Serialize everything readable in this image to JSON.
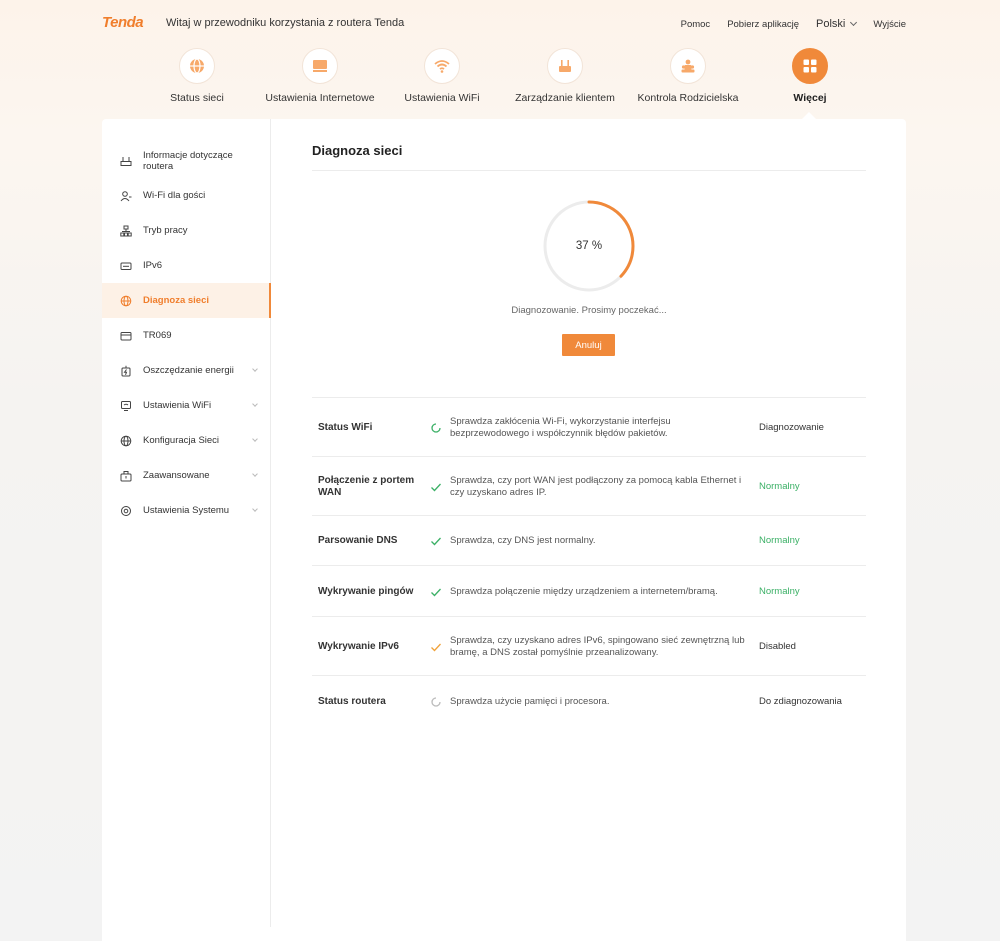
{
  "header": {
    "logo": "Tenda",
    "welcome": "Witaj w przewodniku korzystania z routera Tenda",
    "help": "Pomoc",
    "download": "Pobierz aplikację",
    "language": "Polski",
    "logout": "Wyjście"
  },
  "nav": {
    "items": [
      {
        "label": "Status sieci",
        "icon": "globe-icon"
      },
      {
        "label": "Ustawienia Internetowe",
        "icon": "ethernet-icon"
      },
      {
        "label": "Ustawienia WiFi",
        "icon": "wifi-icon"
      },
      {
        "label": "Zarządzanie klientem",
        "icon": "router-icon"
      },
      {
        "label": "Kontrola Rodzicielska",
        "icon": "family-icon"
      },
      {
        "label": "Więcej",
        "icon": "grid-icon"
      }
    ],
    "active_index": 5,
    "accent_color": "#f0893a"
  },
  "sidebar": {
    "items": [
      {
        "label": "Informacje dotyczące routera",
        "icon": "router-info-icon"
      },
      {
        "label": "Wi-Fi dla gości",
        "icon": "guest-icon"
      },
      {
        "label": "Tryb pracy",
        "icon": "topology-icon"
      },
      {
        "label": "IPv6",
        "icon": "ipv6-icon"
      },
      {
        "label": "Diagnoza sieci",
        "icon": "globe-icon"
      },
      {
        "label": "TR069",
        "icon": "card-icon"
      },
      {
        "label": "Oszczędzanie energii",
        "icon": "energy-icon"
      },
      {
        "label": "Ustawienia WiFi",
        "icon": "wifi-settings-icon"
      },
      {
        "label": "Konfiguracja Sieci",
        "icon": "network-icon"
      },
      {
        "label": "Zaawansowane",
        "icon": "toolbox-icon"
      },
      {
        "label": "Ustawienia Systemu",
        "icon": "gear-icon"
      }
    ],
    "active_index": 4
  },
  "main": {
    "title": "Diagnoza sieci",
    "progress_percent": 37,
    "progress_label": "37 %",
    "status_text": "Diagnozowanie. Prosimy poczekać...",
    "cancel_label": "Anuluj",
    "checks": [
      {
        "name": "Status WiFi",
        "description": "Sprawdza zakłócenia Wi-Fi, wykorzystanie interfejsu bezprzewodowego i współczynnik błędów pakietów.",
        "status": "Diagnozowanie",
        "state": "loading"
      },
      {
        "name": "Połączenie z portem WAN",
        "description": "Sprawdza, czy port WAN jest podłączony za pomocą kabla Ethernet i czy uzyskano adres IP.",
        "status": "Normalny",
        "state": "ok"
      },
      {
        "name": "Parsowanie DNS",
        "description": "Sprawdza, czy DNS jest normalny.",
        "status": "Normalny",
        "state": "ok"
      },
      {
        "name": "Wykrywanie pingów",
        "description": "Sprawdza połączenie między urządzeniem a internetem/bramą.",
        "status": "Normalny",
        "state": "ok"
      },
      {
        "name": "Wykrywanie IPv6",
        "description": "Sprawdza, czy uzyskano adres IPv6, spingowano sieć zewnętrzną lub bramę, a DNS został pomyślnie przeanalizowany.",
        "status": "Disabled",
        "state": "warn"
      },
      {
        "name": "Status routera",
        "description": "Sprawdza użycie pamięci i procesora.",
        "status": "Do zdiagnozowania",
        "state": "pending"
      }
    ]
  }
}
